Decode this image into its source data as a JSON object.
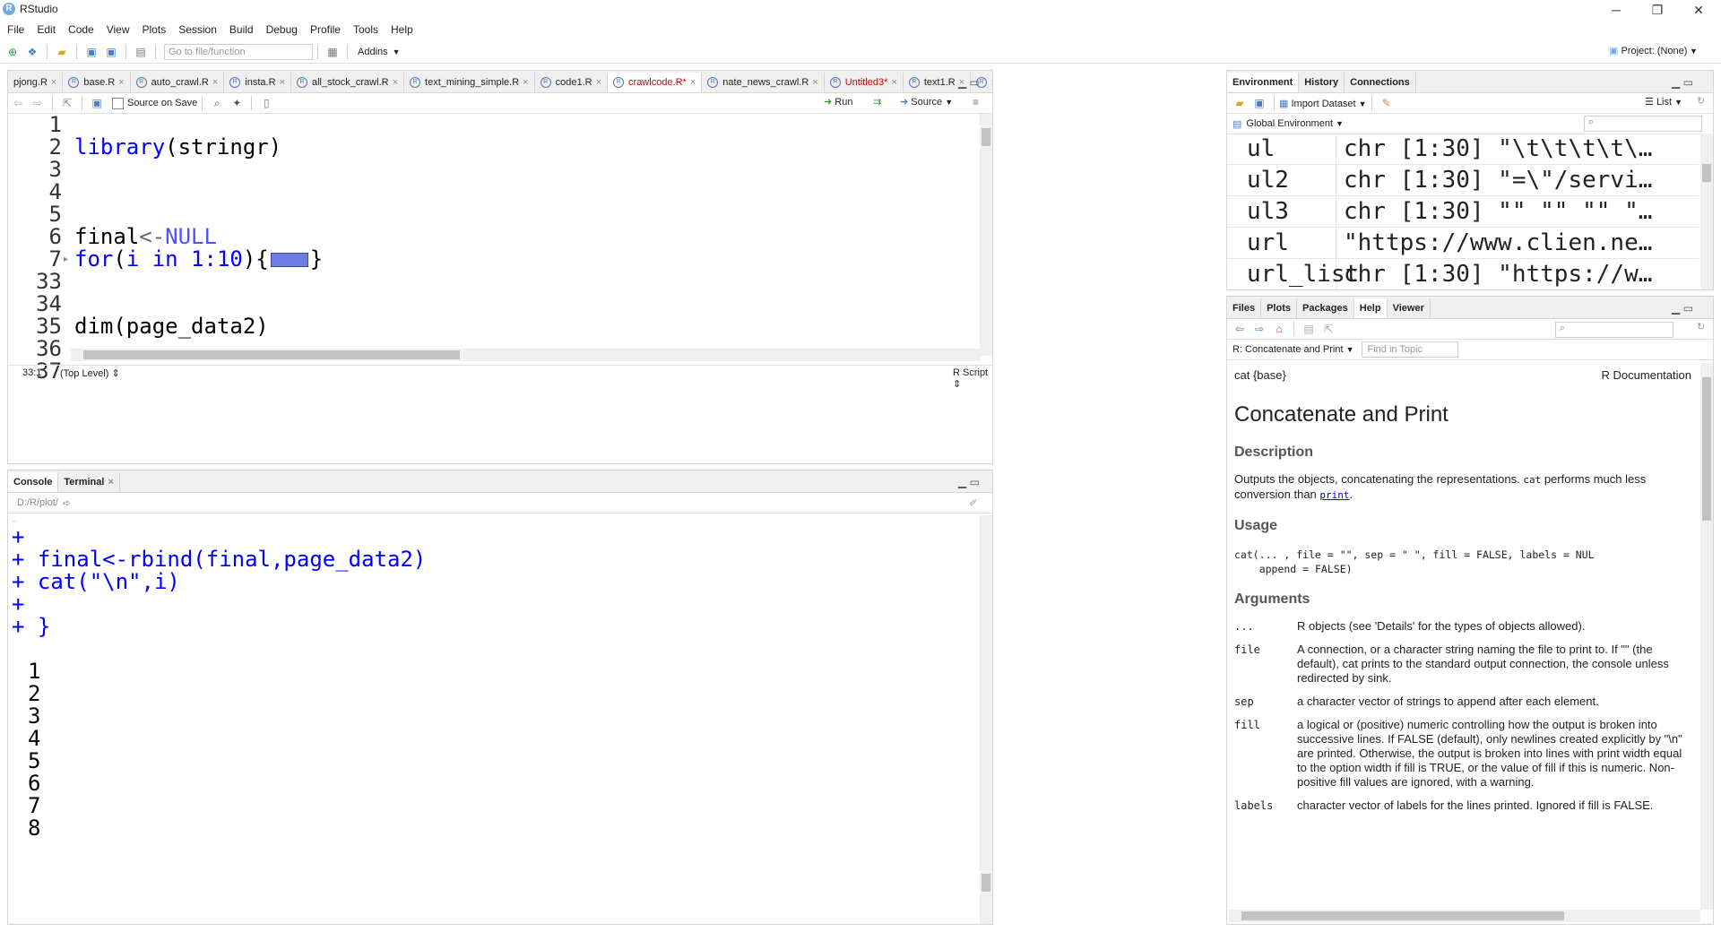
{
  "window": {
    "title": "RStudio",
    "minimize": "─",
    "maximize": "❐",
    "close": "✕"
  },
  "menu": [
    "File",
    "Edit",
    "Code",
    "View",
    "Plots",
    "Session",
    "Build",
    "Debug",
    "Profile",
    "Tools",
    "Help"
  ],
  "toolbar": {
    "goto_placeholder": "Go to file/function",
    "addins": "Addins",
    "project": "Project: (None)"
  },
  "editor": {
    "tabs": [
      {
        "label": "pjong.R",
        "modified": false
      },
      {
        "label": "base.R",
        "modified": false
      },
      {
        "label": "auto_crawl.R",
        "modified": false
      },
      {
        "label": "insta.R",
        "modified": false
      },
      {
        "label": "all_stock_crawl.R",
        "modified": false
      },
      {
        "label": "text_mining_simple.R",
        "modified": false
      },
      {
        "label": "code1.R",
        "modified": false
      },
      {
        "label": "crawlcode.R*",
        "modified": true
      },
      {
        "label": "nate_news_crawl.R",
        "modified": false
      },
      {
        "label": "Untitled3*",
        "modified": true
      },
      {
        "label": "text1.R",
        "modified": false
      }
    ],
    "source_on_save": "Source on Save",
    "run": "Run",
    "source": "Source",
    "lines": [
      {
        "num": "1",
        "text": ""
      },
      {
        "num": "2",
        "text": "library(stringr)"
      },
      {
        "num": "3",
        "text": ""
      },
      {
        "num": "4",
        "text": ""
      },
      {
        "num": "5",
        "text": ""
      },
      {
        "num": "6",
        "text": "final<-NULL"
      },
      {
        "num": "7",
        "text": "for(i in 1:10){"
      },
      {
        "num": "33",
        "text": ""
      },
      {
        "num": "34",
        "text": ""
      },
      {
        "num": "35",
        "text": "dim(page_data2)"
      },
      {
        "num": "36",
        "text": ""
      },
      {
        "num": "37",
        "text": ""
      }
    ],
    "status_pos": "33:1",
    "status_scope": "(Top Level) ⇕",
    "status_type": "R Script ⇕"
  },
  "console": {
    "tabs": [
      "Console",
      "Terminal"
    ],
    "path": "D:/R/plot/",
    "lines": [
      "+",
      "+ final<-rbind(final,page_data2)",
      "+ cat(\"\\n\",i)",
      "+",
      "+ }"
    ],
    "output": [
      "1",
      "2",
      "3",
      "4",
      "5",
      "6",
      "7",
      "8"
    ]
  },
  "environment": {
    "tabs": [
      "Environment",
      "History",
      "Connections"
    ],
    "import": "Import Dataset",
    "list": "List",
    "scope": "Global Environment",
    "rows": [
      {
        "name": "ul",
        "value": "chr [1:30] \"\\t\\t\\t\\t\\…"
      },
      {
        "name": "ul2",
        "value": "chr [1:30] \"=\\\"/servi…"
      },
      {
        "name": "ul3",
        "value": "chr [1:30] \"\" \"\" \"\" \"…"
      },
      {
        "name": "url",
        "value": "\"https://www.clien.ne…"
      },
      {
        "name": "url_list",
        "value": "chr [1:30] \"https://w…"
      }
    ]
  },
  "help": {
    "tabs": [
      "Files",
      "Plots",
      "Packages",
      "Help",
      "Viewer"
    ],
    "topic": "R: Concatenate and Print",
    "find_placeholder": "Find in Topic",
    "pkg": "cat {base}",
    "rdoc": "R Documentation",
    "title": "Concatenate and Print",
    "desc_h": "Description",
    "desc_1": "Outputs the objects, concatenating the representations.",
    "desc_cat": "cat",
    "desc_2": "performs much less conversion than",
    "desc_print": "print",
    "usage_h": "Usage",
    "usage_1": "cat(... , file = \"\", sep = \" \", fill = FALSE, labels = NUL",
    "usage_2": "    append = FALSE)",
    "args_h": "Arguments",
    "args": [
      {
        "name": "...",
        "desc": "R objects (see 'Details' for the types of objects allowed)."
      },
      {
        "name": "file",
        "desc": "A connection, or a character string naming the file to print to. If \"\" (the default), cat prints to the standard output connection, the console unless redirected by sink."
      },
      {
        "name": "sep",
        "desc": "a character vector of strings to append after each element."
      },
      {
        "name": "fill",
        "desc": "a logical or (positive) numeric controlling how the output is broken into successive lines. If FALSE (default), only newlines created explicitly by \"\\n\" are printed. Otherwise, the output is broken into lines with print width equal to the option width if fill is TRUE, or the value of fill if this is numeric. Non-positive fill values are ignored, with a warning."
      },
      {
        "name": "labels",
        "desc": "character vector of labels for the lines printed. Ignored if fill is FALSE."
      }
    ]
  },
  "colors": {
    "keyword": "#0000ff",
    "code": "#000000",
    "console_input": "#0000ff",
    "tab_modified": "#c80000"
  }
}
